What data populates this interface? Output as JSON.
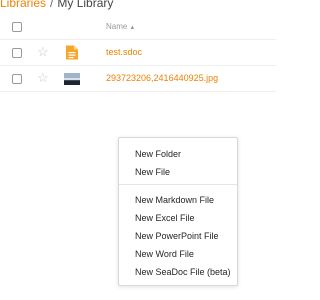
{
  "breadcrumb": {
    "root": "Libraries",
    "separator": "/",
    "current": "My Library"
  },
  "table": {
    "name_header": "Name",
    "sort_icon": "▲",
    "rows": [
      {
        "name": "test.sdoc",
        "icon": "sdoc-file-icon",
        "starred": false
      },
      {
        "name": "293723206,2416440925.jpg",
        "icon": "image-thumbnail",
        "starred": false
      }
    ]
  },
  "context_menu": {
    "new_folder": "New Folder",
    "new_file": "New File",
    "new_markdown": "New Markdown File",
    "new_excel": "New Excel File",
    "new_powerpoint": "New PowerPoint File",
    "new_word": "New Word File",
    "new_seadoc": "New SeaDoc File (beta)"
  },
  "colors": {
    "accent": "#eb8205",
    "star": "#c8c8c8"
  },
  "icons": {
    "star": "☆"
  }
}
